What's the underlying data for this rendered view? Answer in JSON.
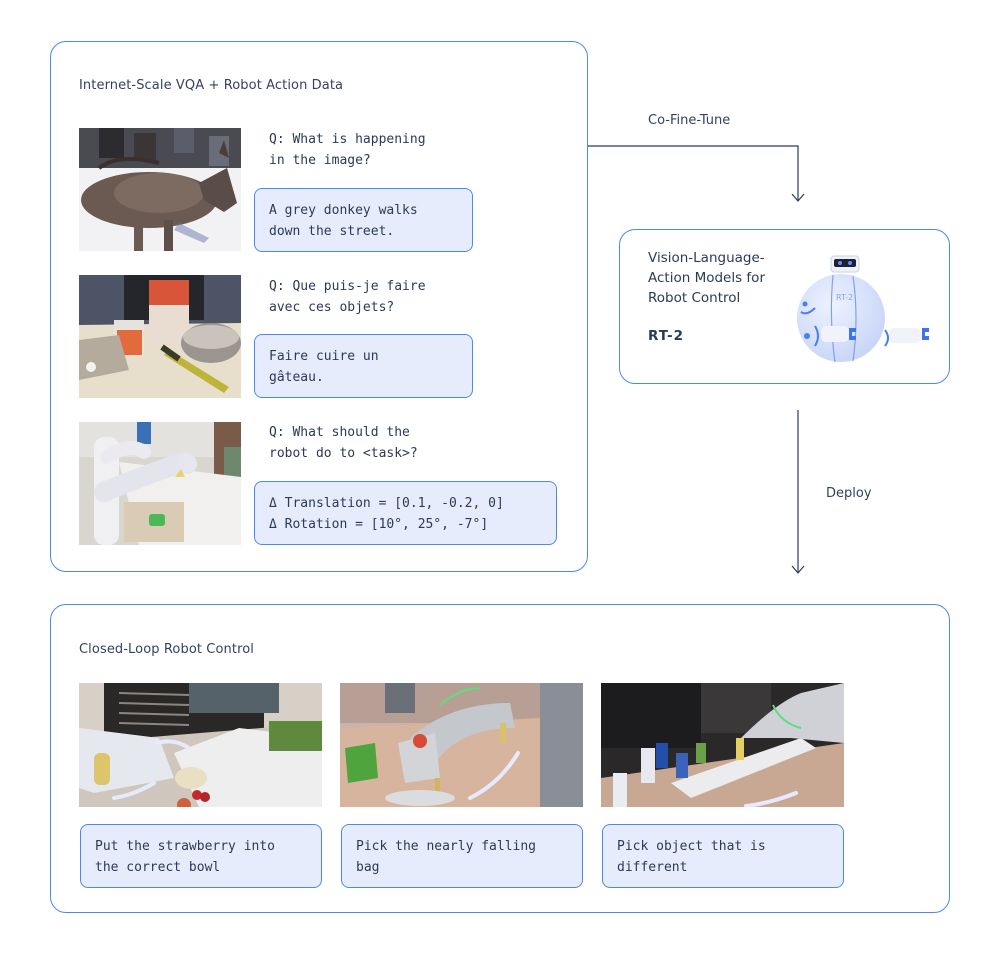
{
  "vqa_panel": {
    "title": "Internet-Scale VQA + Robot Action Data",
    "examples": [
      {
        "image": "donkey-photo",
        "question": "Q: What is happening\nin the image?",
        "answer": "A grey donkey walks\ndown the street."
      },
      {
        "image": "kitchen-ingredients-photo",
        "question": "Q: Que puis-je faire\navec ces objets?",
        "answer": "Faire cuire un\ngâteau."
      },
      {
        "image": "robot-arm-photo",
        "question": "Q: What should the\nrobot do to <task>?",
        "answer": "Δ Translation = [0.1, -0.2, 0]\nΔ Rotation = [10°, 25°, -7°]"
      }
    ]
  },
  "arrows": {
    "co_fine_tune": "Co-Fine-Tune",
    "deploy": "Deploy"
  },
  "model_panel": {
    "description": "Vision-Language-\nAction Models for\nRobot Control",
    "model_name": "RT-2",
    "robot_label": "RT-2",
    "icon": "robot-mascot-icon"
  },
  "control_panel": {
    "title": "Closed-Loop Robot Control",
    "tasks": [
      {
        "image": "strawberry-bowl-photo",
        "caption": "Put the strawberry into\nthe correct bowl"
      },
      {
        "image": "falling-bag-photo",
        "caption": "Pick the nearly falling\nbag"
      },
      {
        "image": "different-object-photo",
        "caption": "Pick object that is\ndifferent"
      }
    ]
  },
  "colors": {
    "accent_border": "#4a8af0",
    "answer_fill": "#e6ecfb",
    "arrow": "#2b3a5c",
    "text": "#2d3a55"
  }
}
